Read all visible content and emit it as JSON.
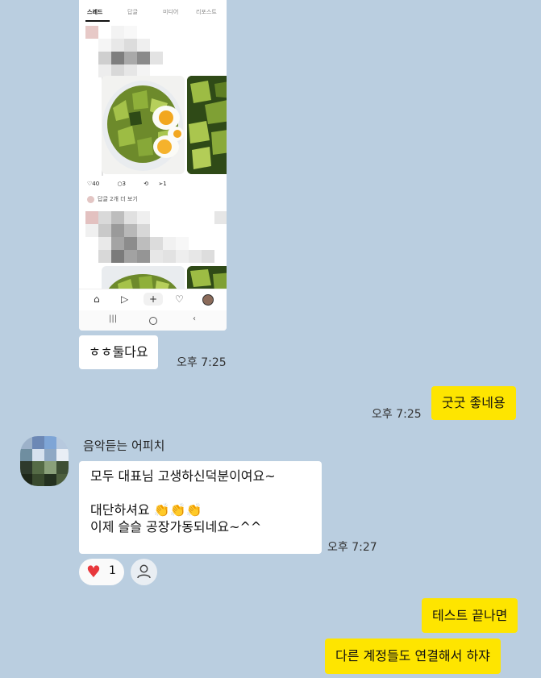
{
  "embedded_screenshot": {
    "tabs": [
      "스레드",
      "답글",
      "미디어",
      "리포스트"
    ],
    "post_actions": {
      "likes": "40",
      "comments": "3",
      "reposts": "",
      "shares": "1"
    },
    "more_replies": "답글 2개 더 보기",
    "nav_icons": [
      "home-icon",
      "send-icon",
      "plus-icon",
      "heart-icon",
      "profile-icon"
    ],
    "system_icons": [
      "recent-apps-icon",
      "home-circle-icon",
      "back-icon"
    ]
  },
  "messages": [
    {
      "id": "m1",
      "side": "left",
      "text": "ㅎㅎ둘다요",
      "time": "오후 7:25"
    },
    {
      "id": "m2",
      "side": "right",
      "text": "굿굿 좋네용",
      "time": "오후 7:25"
    },
    {
      "id": "m3",
      "side": "left",
      "sender": "음악듣는 어피치",
      "lines": [
        "모두 대표님 고생하신덕분이여요~",
        "",
        "대단하셔요 👏👏👏",
        "이제 슬슬 공장가동되네요~^^"
      ],
      "time": "오후 7:27",
      "reaction": {
        "emoji": "♥",
        "count": "1"
      }
    },
    {
      "id": "m4",
      "side": "right",
      "text": "테스트 끝나면"
    },
    {
      "id": "m5",
      "side": "right",
      "text": "다른 계정들도 연결해서 하쟈"
    }
  ],
  "colors": {
    "background": "#bacee0",
    "my_bubble": "#fee500",
    "other_bubble": "#ffffff",
    "heart": "#e8373c"
  }
}
